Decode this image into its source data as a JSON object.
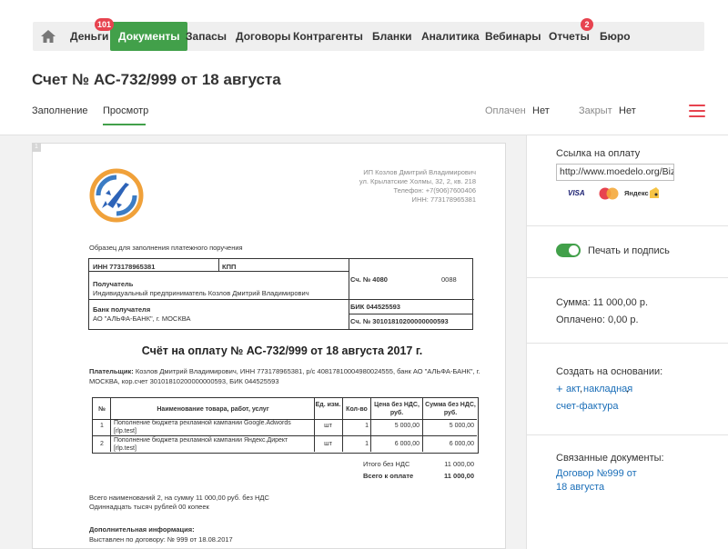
{
  "nav": {
    "home_icon": "home-icon",
    "items": [
      "Деньги",
      "Документы",
      "Запасы",
      "Договоры",
      "Контрагенты",
      "Бланки",
      "Аналитика",
      "Вебинары",
      "Отчеты",
      "Бюро"
    ],
    "active": "Документы",
    "badges": {
      "money": "101",
      "reports": "2"
    }
  },
  "page_title": "Счет № АС-732/999 от 18 августа",
  "tabs": [
    "Заполнение",
    "Просмотр"
  ],
  "active_tab": "Просмотр",
  "status": {
    "paid_label": "Оплачен",
    "paid_value": "Нет",
    "closed_label": "Закрыт",
    "closed_value": "Нет"
  },
  "document": {
    "page_number": "1",
    "company": {
      "name": "ИП Козлов Дмитрий Владимирович",
      "address": "ул. Крылатские Холмы, 32, 2, кв. 218",
      "phone": "Телефон: +7(906)7600406",
      "inn": "ИНН: 773178965381"
    },
    "sample_label": "Образец для заполнения платежного поручения",
    "bank_table": {
      "inn": "ИНН 773178965381",
      "kpp": "КПП",
      "account_label": "Сч. № 4080",
      "account_tail": "0088",
      "recipient_label": "Получатель",
      "recipient": "Индивидуальный предприниматель Козлов Дмитрий Владимирович",
      "bank_label": "Банк получателя",
      "bank": "АО \"АЛЬФА-БАНК\", г. МОСКВА",
      "bik": "БИК 044525593",
      "corr_account": "Сч. № 30101810200000000593"
    },
    "invoice_title": "Счёт на оплату № АС-732/999 от 18 августа 2017 г.",
    "payer_label": "Плательщик:",
    "payer": "Козлов Дмитрий Владимирович, ИНН 773178965381, р/с 40817810004980024555, банк АО \"АЛЬФА-БАНК\", г. МОСКВА, кор.счет 30101810200000000593, БИК 044525593",
    "items_table": {
      "headers": {
        "num": "№",
        "name": "Наименование товара, работ, услуг",
        "unit": "Ед. изм.",
        "qty": "Кол-во",
        "price": "Цена без НДС, руб.",
        "sum": "Сумма без НДС, руб."
      },
      "rows": [
        {
          "num": "1",
          "name": "Пополнение бюджета рекламной кампании Google.Adwords [rlp.test]",
          "unit": "шт",
          "qty": "1",
          "price": "5 000,00",
          "sum": "5 000,00"
        },
        {
          "num": "2",
          "name": "Пополнение бюджета рекламной кампании Яндекс.Директ [rlp.test]",
          "unit": "шт",
          "qty": "1",
          "price": "6 000,00",
          "sum": "6 000,00"
        }
      ]
    },
    "totals": {
      "net_label": "Итого без НДС",
      "net_value": "11 000,00",
      "total_label": "Всего к оплате",
      "total_value": "11 000,00"
    },
    "summary_line1": "Всего наименований 2, на сумму 11 000,00 руб. без НДС",
    "summary_line2": "Одиннадцать тысяч рублей 00 копеек",
    "extra_title": "Дополнительная информация:",
    "extra_text": "Выставлен по договору: № 999 от 18.08.2017"
  },
  "panel": {
    "payment_link_label": "Ссылка на оплату",
    "payment_link_value": "http://www.moedelo.org/Biz",
    "payment_systems": [
      "VISA",
      "MasterCard",
      "Яндекс"
    ],
    "print_sign_label": "Печать и подпись",
    "sum": "Сумма: 11 000,00 р.",
    "paid": "Оплачено: 0,00 р.",
    "create_based_label": "Создать на основании:",
    "create_links": [
      "акт",
      "накладная",
      "счет-фактура"
    ],
    "related_label": "Связанные документы:",
    "related_link_line1": "Договор №999 от",
    "related_link_line2": "18 августа"
  },
  "colors": {
    "accent_green": "#42a04a",
    "badge_red": "#e7434f",
    "link_blue": "#1a6eb8"
  }
}
